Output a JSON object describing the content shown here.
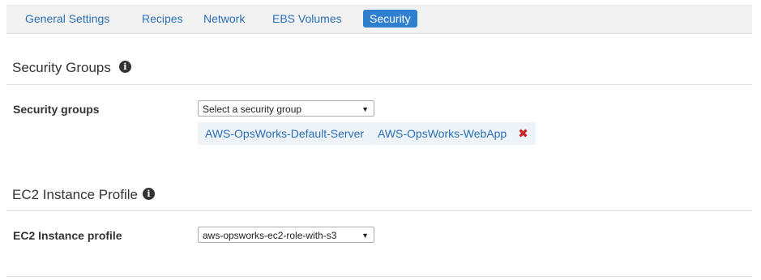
{
  "tabs": [
    {
      "label": "General Settings",
      "active": false
    },
    {
      "label": "Recipes",
      "active": false
    },
    {
      "label": "Network",
      "active": false
    },
    {
      "label": "EBS Volumes",
      "active": false
    },
    {
      "label": "Security",
      "active": true
    }
  ],
  "security_section": {
    "title": "Security Groups",
    "field_label": "Security groups",
    "select_value": "Select a security group",
    "selected_groups": [
      {
        "label": "AWS-OpsWorks-Default-Server",
        "removable": false
      },
      {
        "label": "AWS-OpsWorks-WebApp",
        "removable": true
      }
    ],
    "remove_glyph": "✖"
  },
  "ec2_section": {
    "title": "EC2 Instance Profile",
    "field_label": "EC2 Instance profile",
    "select_value": "aws-opsworks-ec2-role-with-s3"
  },
  "icons": {
    "info": "i",
    "caret": "▼"
  },
  "colors": {
    "accent": "#2f7fd0",
    "link": "#2a6fb5",
    "remove": "#cc2222",
    "tag_bg": "#eef3f8"
  }
}
